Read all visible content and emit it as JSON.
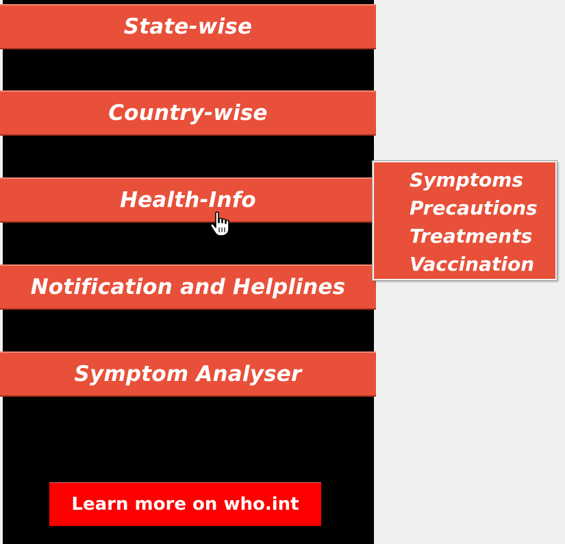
{
  "menu": {
    "items": [
      {
        "label": "State-wise"
      },
      {
        "label": "Country-wise"
      },
      {
        "label": "Health-Info"
      },
      {
        "label": "Notification and Helplines"
      },
      {
        "label": "Symptom Analyser"
      }
    ]
  },
  "health_info_popup": {
    "items": [
      {
        "label": "Symptoms"
      },
      {
        "label": "Precautions"
      },
      {
        "label": "Treatments"
      },
      {
        "label": "Vaccination"
      }
    ]
  },
  "learn_more": {
    "label": "Learn more on who.int"
  },
  "cursor": {
    "icon": "hand-pointer-icon"
  },
  "colors": {
    "menu_button": "#e8503a",
    "learn_button": "#ff0000",
    "sidebar": "#000000",
    "background": "#f0f0f0"
  }
}
